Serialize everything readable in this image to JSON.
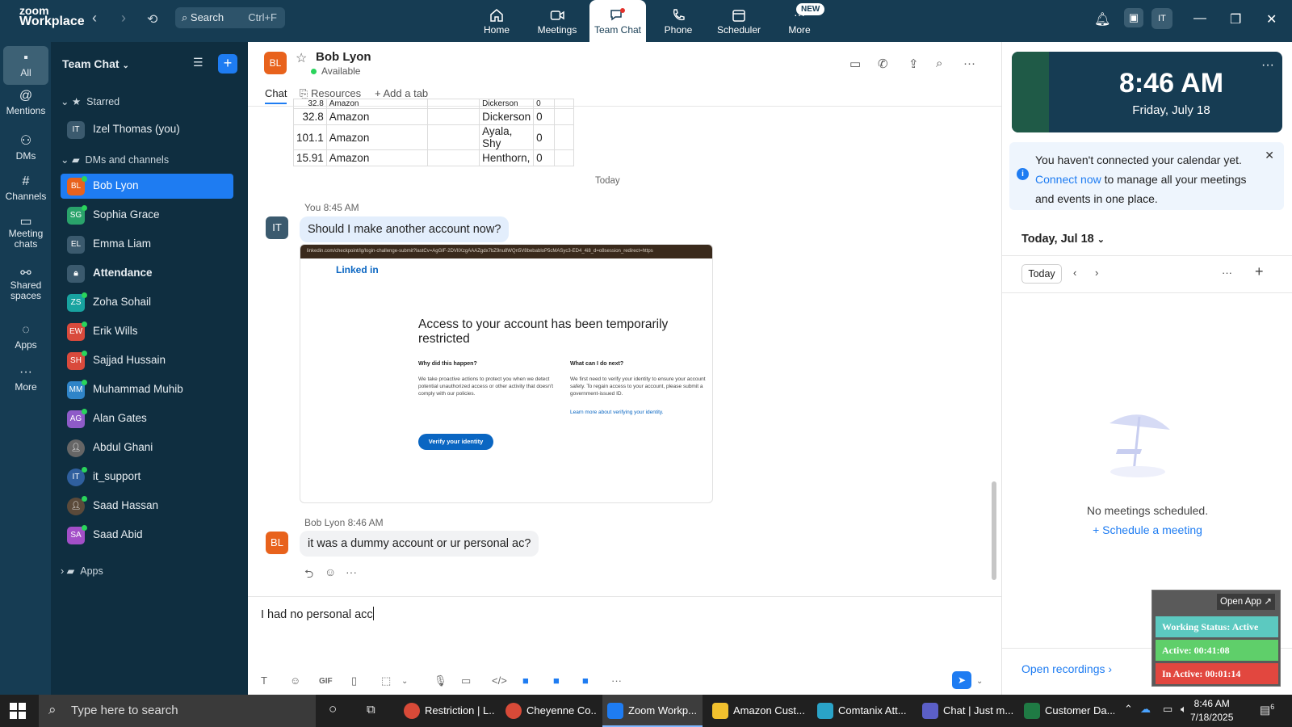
{
  "topbar": {
    "brand_line1": "zoom",
    "brand_line2": "Workplace",
    "search_placeholder": "Search",
    "search_shortcut": "Ctrl+F",
    "tabs": [
      {
        "label": "Home",
        "icon": "home-icon"
      },
      {
        "label": "Meetings",
        "icon": "video-icon"
      },
      {
        "label": "Team Chat",
        "icon": "chat-icon"
      },
      {
        "label": "Phone",
        "icon": "phone-icon"
      },
      {
        "label": "Scheduler",
        "icon": "calendar-icon"
      },
      {
        "label": "More",
        "icon": "more-icon"
      }
    ],
    "new_badge": "NEW",
    "user_initials": "IT"
  },
  "rail": [
    {
      "label": "All"
    },
    {
      "label": "Mentions"
    },
    {
      "label": "DMs"
    },
    {
      "label": "Channels"
    },
    {
      "label": "Meeting chats"
    },
    {
      "label": "Shared spaces"
    },
    {
      "label": "Apps"
    },
    {
      "label": "More"
    }
  ],
  "sidebar": {
    "title": "Team Chat",
    "starred": "Starred",
    "dms_channels": "DMs and channels",
    "apps": "Apps",
    "items": [
      {
        "initials": "IT",
        "name": "Izel Thomas (you)",
        "color": "#3b5a6e"
      },
      {
        "initials": "BL",
        "name": "Bob Lyon",
        "color": "#e8621c"
      },
      {
        "initials": "SG",
        "name": "Sophia Grace",
        "color": "#2aa36b"
      },
      {
        "initials": "EL",
        "name": "Emma Liam",
        "color": "#3b5a6e"
      },
      {
        "initials": "",
        "name": "Attendance",
        "color": "#3b5a6e"
      },
      {
        "initials": "ZS",
        "name": "Zoha Sohail",
        "color": "#18a3a0"
      },
      {
        "initials": "EW",
        "name": "Erik Wills",
        "color": "#d94a3c"
      },
      {
        "initials": "SH",
        "name": "Sajjad Hussain",
        "color": "#d94a3c"
      },
      {
        "initials": "MM",
        "name": "Muhammad Muhib",
        "color": "#2f84c8"
      },
      {
        "initials": "AG",
        "name": "Alan Gates",
        "color": "#8e5bc8"
      },
      {
        "initials": "",
        "name": "Abdul Ghani",
        "color": "#666666"
      },
      {
        "initials": "",
        "name": "it_support",
        "color": "#2f5f9e"
      },
      {
        "initials": "",
        "name": "Saad Hassan",
        "color": "#5b4a3a"
      },
      {
        "initials": "SA",
        "name": "Saad Abid",
        "color": "#a34fc8"
      }
    ]
  },
  "chat": {
    "contact_initials": "BL",
    "contact_name": "Bob Lyon",
    "contact_status": "Available",
    "tabs": [
      "Chat",
      "Resources",
      "Add a tab"
    ],
    "table_rows": [
      [
        "32.8",
        "Amazon",
        "",
        "Dickerson",
        "0"
      ],
      [
        "32.8",
        "Amazon",
        "",
        "Dickerson",
        "0"
      ],
      [
        "101.1",
        "Amazon",
        "",
        "Ayala, Shy",
        "0"
      ],
      [
        "15.91",
        "Amazon",
        "",
        "Henthorn,",
        "0"
      ]
    ],
    "day_separator": "Today",
    "msg1_sender": "You",
    "msg1_time": "8:45 AM",
    "msg1_initials": "IT",
    "msg1_text": "Should I make another account now?",
    "screenshot": {
      "url": "linkedin.com/checkpoint/lg/login-challenge-submit?lastCv=AgGlF-2DVlIXzgAAAZgdx7bZ9nu8WQn5V8bebabloP5cMASyc3-ED4_4i8_d=o8session_redirect=https",
      "logo": "Linked in",
      "heading": "Access to your account has been temporarily restricted",
      "q1": "Why did this happen?",
      "p1": "We take proactive actions to protect you when we detect potential unauthorized access or other activity that doesn't comply with our policies.",
      "q2": "What can I do next?",
      "p2": "We first need to verify your identity to ensure your account safety. To regain access to your account, please submit a government-issued ID.",
      "learn": "Learn more about verifying your identity.",
      "button": "Verify your identity"
    },
    "msg2_sender": "Bob Lyon",
    "msg2_time": "8:46 AM",
    "msg2_initials": "BL",
    "msg2_text": "it was a dummy account or ur personal ac?",
    "compose_text": "I had no personal acc"
  },
  "right": {
    "time": "8:46 AM",
    "date": "Friday, July 18",
    "notice_pre": "You haven't connected your calendar yet.",
    "notice_link": "Connect now",
    "notice_post": "to manage all your meetings and events in one place.",
    "today_label": "Today, Jul 18",
    "today_btn": "Today",
    "no_meetings": "No meetings scheduled.",
    "schedule": "Schedule a meeting",
    "open_recordings": "Open recordings"
  },
  "widget": {
    "open_app": "Open App ↗",
    "status": "Working Status: Active",
    "active": "Active: 00:41:08",
    "inactive": "In Active: 00:01:14",
    "colors": {
      "status": "#5cc9c0",
      "active": "#5fcf6a",
      "inactive": "#e2473f"
    }
  },
  "taskbar": {
    "search": "Type here to search",
    "apps": [
      {
        "label": "Restriction | L...",
        "color": "#d84a38"
      },
      {
        "label": "Cheyenne Co...",
        "color": "#d84a38"
      },
      {
        "label": "Zoom Workp...",
        "color": "#1e7cf2"
      },
      {
        "label": "Amazon Cust...",
        "color": "#f2c12e"
      },
      {
        "label": "Comtanix Att...",
        "color": "#2aa3c8"
      },
      {
        "label": "Chat | Just m...",
        "color": "#5b5fc7"
      },
      {
        "label": "Customer Da...",
        "color": "#1f7a44"
      }
    ],
    "time": "8:46 AM",
    "date": "7/18/2025",
    "notif_count": "6"
  }
}
